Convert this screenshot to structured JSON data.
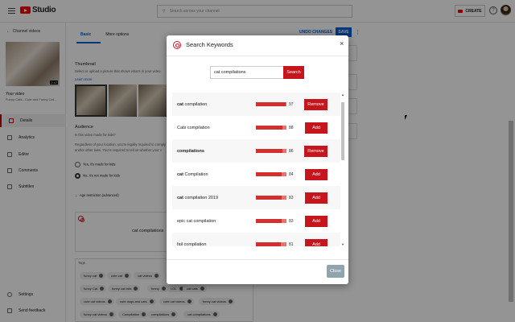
{
  "header": {
    "studio_label": "Studio",
    "search_placeholder": "Search across your channel",
    "create_label": "CREATE",
    "help_label": "?"
  },
  "sidebar": {
    "back_label": "Channel videos",
    "duration": "2:47",
    "your_video_label": "Your video",
    "video_title": "Funny Cats - Cute and Funny Cat...",
    "items": [
      {
        "label": "Details",
        "active": true
      },
      {
        "label": "Analytics"
      },
      {
        "label": "Editor"
      },
      {
        "label": "Comments"
      },
      {
        "label": "Subtitles"
      }
    ],
    "footer": [
      {
        "label": "Settings"
      },
      {
        "label": "Send feedback"
      }
    ]
  },
  "editor": {
    "tabs": [
      "Basic",
      "More options"
    ],
    "undo_label": "UNDO CHANGES",
    "save_label": "SAVE",
    "thumbnail_title": "Thumbnail",
    "thumbnail_text": "Select or upload a picture that shows what's in your video.",
    "learn_more": "Learn more",
    "audience_title": "Audience",
    "kids_question": "Is this video made for kids?",
    "kids_text1": "Regardless of your location, you're legally required to comply",
    "kids_text2": "and/or other laws. You're required to tell us whether your v",
    "radio_yes": "Yes, it's made for kids",
    "radio_no": "No, it's not made for kids",
    "age_restriction": "Age restriction (advanced)",
    "keyword_field": "cat compilations",
    "tags_label": "Tags",
    "tags": [
      "funny cat",
      "cute cat",
      "cat videos",
      "cute cats",
      "funny Cat",
      "funny cat fails",
      "funny",
      "LOL",
      "cat cats",
      "cute cat videos",
      "cute dogs and cats",
      "cute cat videos",
      "funny cat videos",
      "funny cat videos",
      "Compilation",
      "compilations",
      "cat compilations"
    ]
  },
  "modal": {
    "title": "Search Keywords",
    "close_x": "×",
    "input_value": "cat compilations",
    "search_label": "Search",
    "close_label": "Close",
    "results": [
      {
        "prefix": "cat",
        "rest": " compilation",
        "score": 97,
        "action": "Remove"
      },
      {
        "prefix": "",
        "rest": "Cats compilation",
        "score": 88,
        "action": "Add"
      },
      {
        "prefix": "compilations",
        "rest": "",
        "score": 86,
        "action": "Remove"
      },
      {
        "prefix": "cat",
        "rest": " Compilation",
        "score": 84,
        "action": "Add"
      },
      {
        "prefix": "cat",
        "rest": " compilation 2019",
        "score": 83,
        "action": "Add"
      },
      {
        "prefix": "",
        "rest": "epic cat compilation",
        "score": 83,
        "action": "Add"
      },
      {
        "prefix": "",
        "rest": "fail compilation",
        "score": 81,
        "action": "Add"
      }
    ]
  }
}
